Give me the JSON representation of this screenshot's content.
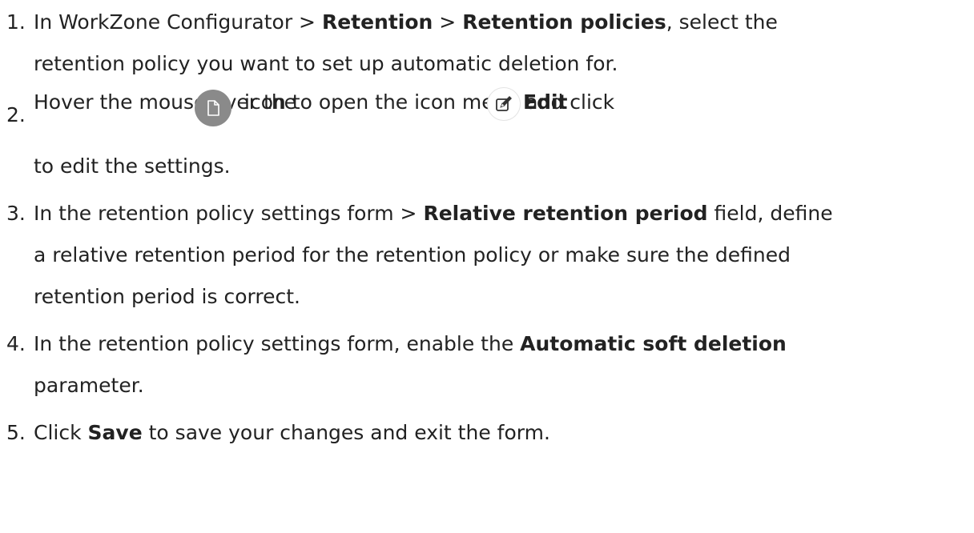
{
  "steps": [
    {
      "number": "1.",
      "line1": {
        "a": "In WorkZone Configurator  > ",
        "b": "Retention",
        "c": " > ",
        "d": "Retention policies",
        "e": ", select the"
      },
      "line2": "retention policy you want to set up automatic deletion for."
    },
    {
      "number": "2.",
      "line1": {
        "a": "Hover the mouse over the",
        "b": "icon to open the icon menu and click",
        "c": "Edit"
      },
      "line2": "to edit the settings.",
      "icons": [
        "document-icon",
        "edit-icon"
      ]
    },
    {
      "number": "3.",
      "line1": {
        "a": "In the retention policy settings form > ",
        "b": "Relative retention period",
        "c": " field, define"
      },
      "line2": "a relative retention period for the retention policy or make sure the defined",
      "line3": "retention period is correct."
    },
    {
      "number": "4.",
      "line1": {
        "a": "In the retention policy settings form, enable the ",
        "b": "Automatic soft deletion"
      },
      "line2": "parameter."
    },
    {
      "number": "5.",
      "line1": {
        "a": "Click ",
        "b": "Save",
        "c": " to save your changes and exit the form."
      }
    }
  ],
  "colors": {
    "text": "#222222",
    "doc_icon_bg": "#8a8a8a",
    "edit_icon_border": "#e3e3e3"
  }
}
